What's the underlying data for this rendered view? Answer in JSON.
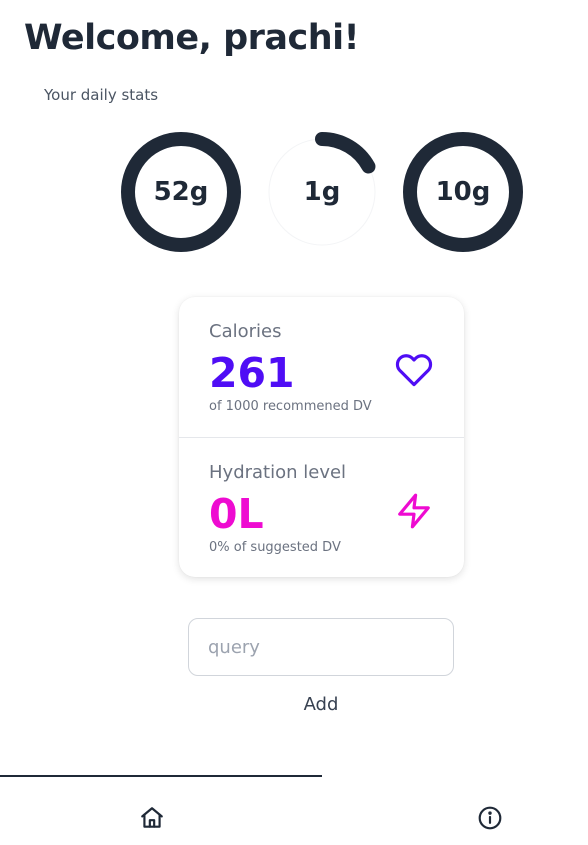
{
  "header": {
    "title": "Welcome, prachi!",
    "subtitle": "Your daily stats"
  },
  "rings": [
    {
      "value": "52g",
      "progress": 1.0
    },
    {
      "value": "1g",
      "progress": 0.17
    },
    {
      "value": "10g",
      "progress": 1.0
    }
  ],
  "stats": {
    "calories": {
      "label": "Calories",
      "value": "261",
      "note": "of 1000 recommened DV",
      "icon": "heart-icon",
      "color": "#4f0df5"
    },
    "hydration": {
      "label": "Hydration level",
      "value": "0L",
      "note": "0% of suggested DV",
      "icon": "lightning-icon",
      "color": "#ee0bd1"
    }
  },
  "query": {
    "placeholder": "query",
    "value": "",
    "add_label": "Add"
  },
  "nav": {
    "items": [
      "home-icon",
      "info-icon"
    ]
  },
  "colors": {
    "ring": "#1f2937",
    "ring_track": "#f3f4f6"
  }
}
